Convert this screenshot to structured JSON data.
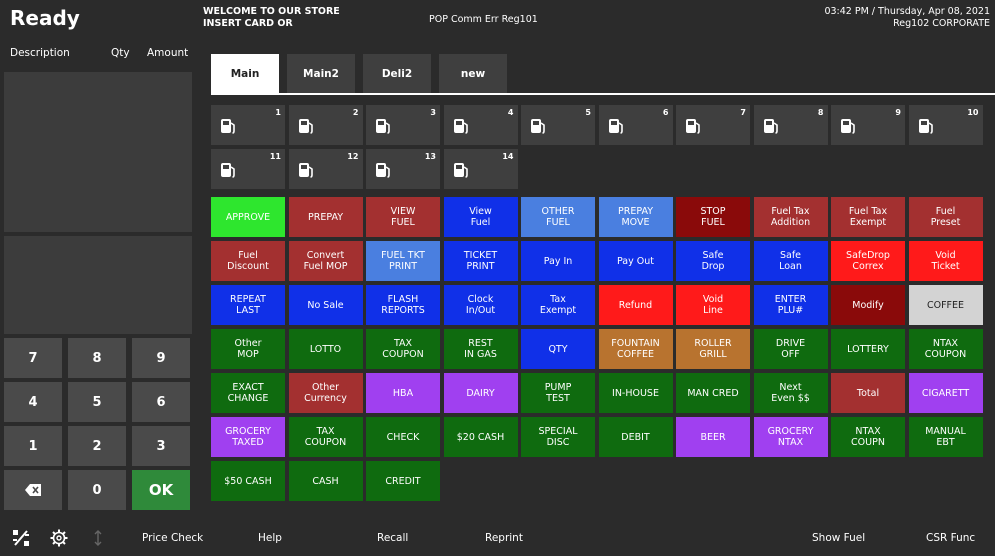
{
  "header": {
    "status": "Ready",
    "welcome_line1": "WELCOME TO OUR STORE",
    "welcome_line2": "INSERT CARD OR",
    "pop_status": "POP Comm Err Reg101",
    "datetime": "03:42 PM / Thursday, Apr 08, 2021",
    "register": "Reg102  CORPORATE"
  },
  "transaction": {
    "col_description": "Description",
    "col_qty": "Qty",
    "col_amount": "Amount"
  },
  "keypad": {
    "keys": [
      "7",
      "8",
      "9",
      "4",
      "5",
      "6",
      "1",
      "2",
      "3",
      "⌫",
      "0",
      "OK"
    ]
  },
  "tabs": [
    {
      "label": "Main",
      "active": true
    },
    {
      "label": "Main2",
      "active": false
    },
    {
      "label": "Deli2",
      "active": false
    },
    {
      "label": "new",
      "active": false
    }
  ],
  "pumps": [
    "1",
    "2",
    "3",
    "4",
    "5",
    "6",
    "7",
    "8",
    "9",
    "10",
    "11",
    "12",
    "13",
    "14"
  ],
  "buttons": [
    {
      "label": "APPROVE",
      "color": "#2ee62e"
    },
    {
      "label": "PREPAY",
      "color": "#a33030"
    },
    {
      "label": "VIEW\nFUEL",
      "color": "#a33030"
    },
    {
      "label": "View\nFuel",
      "color": "#1030e8"
    },
    {
      "label": "OTHER\nFUEL",
      "color": "#4a7fe0"
    },
    {
      "label": "PREPAY\nMOVE",
      "color": "#4a7fe0"
    },
    {
      "label": "STOP\nFUEL",
      "color": "#8a0a0a"
    },
    {
      "label": "Fuel Tax\nAddition",
      "color": "#a33030"
    },
    {
      "label": "Fuel Tax\nExempt",
      "color": "#a33030"
    },
    {
      "label": "Fuel\nPreset",
      "color": "#a33030"
    },
    {
      "label": "Fuel\nDiscount",
      "color": "#a33030"
    },
    {
      "label": "Convert\nFuel MOP",
      "color": "#a33030"
    },
    {
      "label": "FUEL TKT\nPRINT",
      "color": "#4a7fe0"
    },
    {
      "label": "TICKET\nPRINT",
      "color": "#1030e8"
    },
    {
      "label": "Pay In",
      "color": "#1030e8"
    },
    {
      "label": "Pay Out",
      "color": "#1030e8"
    },
    {
      "label": "Safe\nDrop",
      "color": "#1030e8"
    },
    {
      "label": "Safe\nLoan",
      "color": "#1030e8"
    },
    {
      "label": "SafeDrop\nCorrex",
      "color": "#ff1a1a"
    },
    {
      "label": "Void\nTicket",
      "color": "#ff1a1a"
    },
    {
      "label": "REPEAT\nLAST",
      "color": "#1030e8"
    },
    {
      "label": "No Sale",
      "color": "#1030e8"
    },
    {
      "label": "FLASH\nREPORTS",
      "color": "#1030e8"
    },
    {
      "label": "Clock\nIn/Out",
      "color": "#1030e8"
    },
    {
      "label": "Tax\nExempt",
      "color": "#1030e8"
    },
    {
      "label": "Refund",
      "color": "#ff1a1a"
    },
    {
      "label": "Void\nLine",
      "color": "#ff1a1a"
    },
    {
      "label": "ENTER\nPLU#",
      "color": "#1030e8"
    },
    {
      "label": "Modify",
      "color": "#8a0a0a"
    },
    {
      "label": "COFFEE",
      "color": "#d3d3d3"
    },
    {
      "label": "Other\nMOP",
      "color": "#0f6b0f"
    },
    {
      "label": "LOTTO",
      "color": "#0f6b0f"
    },
    {
      "label": "TAX\nCOUPON",
      "color": "#0f6b0f"
    },
    {
      "label": "REST\nIN GAS",
      "color": "#0f6b0f"
    },
    {
      "label": "QTY",
      "color": "#1030e8"
    },
    {
      "label": "FOUNTAIN\nCOFFEE",
      "color": "#b8732f"
    },
    {
      "label": "ROLLER\nGRILL",
      "color": "#b8732f"
    },
    {
      "label": "DRIVE\nOFF",
      "color": "#0f6b0f"
    },
    {
      "label": "LOTTERY",
      "color": "#0f6b0f"
    },
    {
      "label": "NTAX\nCOUPON",
      "color": "#0f6b0f"
    },
    {
      "label": "EXACT\nCHANGE",
      "color": "#0f6b0f"
    },
    {
      "label": "Other\nCurrency",
      "color": "#a33030"
    },
    {
      "label": "HBA",
      "color": "#a040f0"
    },
    {
      "label": "DAIRY",
      "color": "#a040f0"
    },
    {
      "label": "PUMP\nTEST",
      "color": "#0f6b0f"
    },
    {
      "label": "IN-HOUSE",
      "color": "#0f6b0f"
    },
    {
      "label": "MAN CRED",
      "color": "#0f6b0f"
    },
    {
      "label": "Next\nEven $$",
      "color": "#0f6b0f"
    },
    {
      "label": "Total",
      "color": "#a33030"
    },
    {
      "label": "CIGARETT",
      "color": "#a040f0"
    },
    {
      "label": "GROCERY\nTAXED",
      "color": "#a040f0"
    },
    {
      "label": "TAX\nCOUPON",
      "color": "#0f6b0f"
    },
    {
      "label": "CHECK",
      "color": "#0f6b0f"
    },
    {
      "label": "$20 CASH",
      "color": "#0f6b0f"
    },
    {
      "label": "SPECIAL\nDISC",
      "color": "#0f6b0f"
    },
    {
      "label": "DEBIT",
      "color": "#0f6b0f"
    },
    {
      "label": "BEER",
      "color": "#a040f0"
    },
    {
      "label": "GROCERY\nNTAX",
      "color": "#a040f0"
    },
    {
      "label": "NTAX\nCOUPN",
      "color": "#0f6b0f"
    },
    {
      "label": "MANUAL\nEBT",
      "color": "#0f6b0f"
    },
    {
      "label": "$50 CASH",
      "color": "#0f6b0f"
    },
    {
      "label": "CASH",
      "color": "#0f6b0f"
    },
    {
      "label": "CREDIT",
      "color": "#0f6b0f"
    }
  ],
  "bottombar": {
    "icons": [
      "discount-icon",
      "settings-gear-icon",
      "up-down-arrow-icon"
    ],
    "price_check": "Price Check",
    "help": "Help",
    "recall": "Recall",
    "reprint": "Reprint",
    "show_fuel": "Show Fuel",
    "csr_func": "CSR Func"
  }
}
